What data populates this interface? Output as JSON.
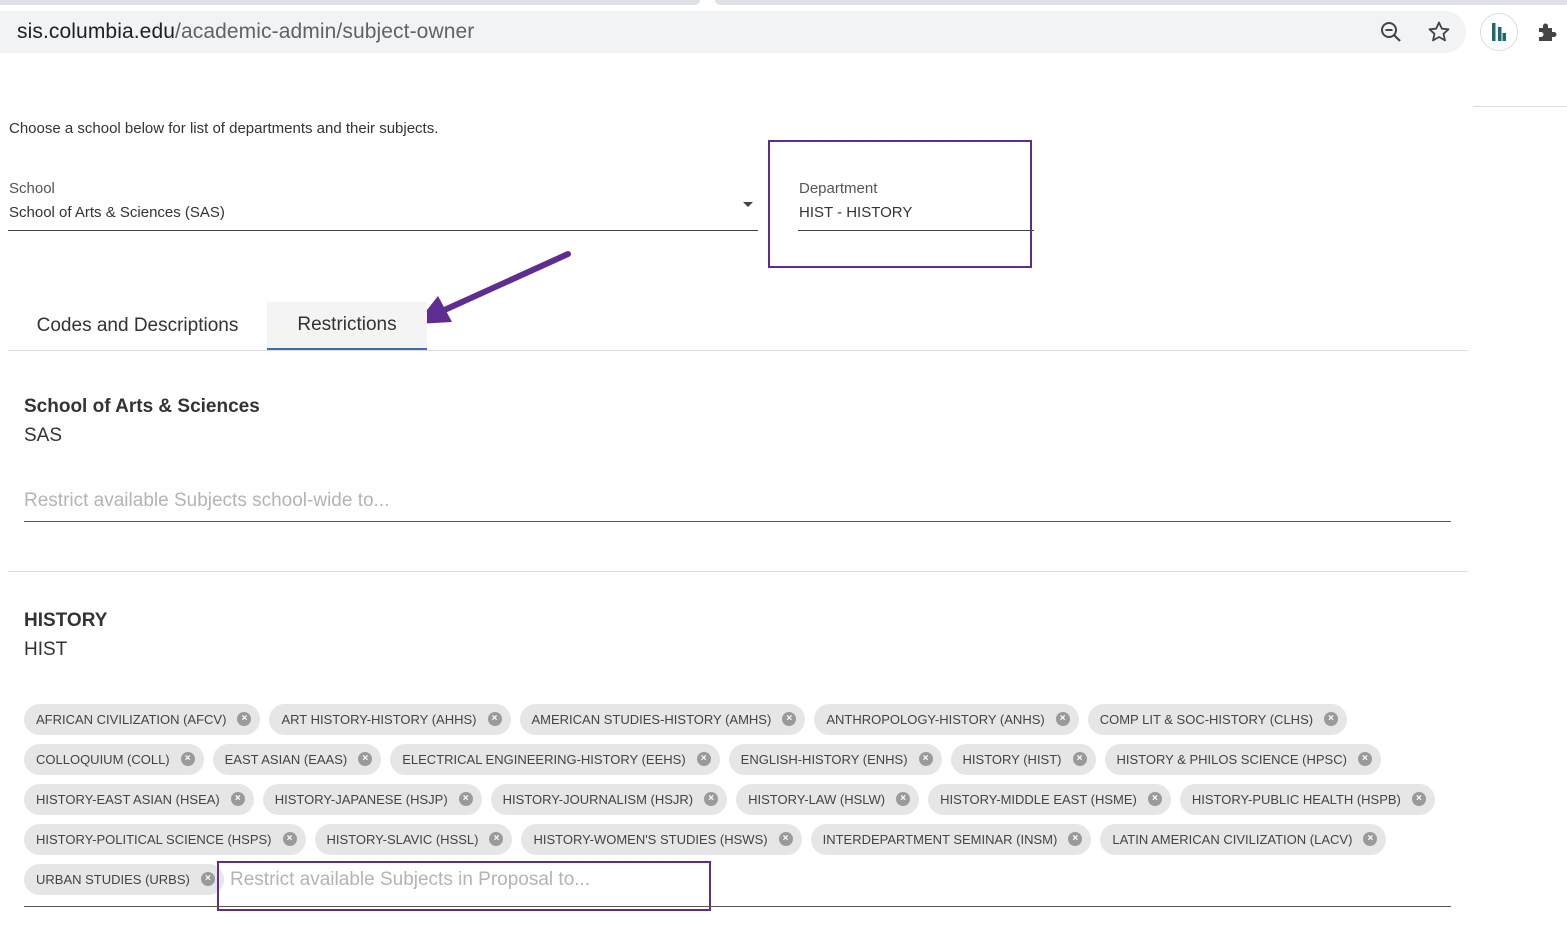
{
  "browser": {
    "url_host": "sis.columbia.edu",
    "url_path": "/academic-admin/subject-owner"
  },
  "intro": "Choose a school below for list of departments and their subjects.",
  "school_field": {
    "label": "School",
    "value": "School of Arts & Sciences (SAS)"
  },
  "department_field": {
    "label": "Department",
    "value": "HIST - HISTORY"
  },
  "tabs": [
    {
      "label": "Codes and Descriptions",
      "active": false
    },
    {
      "label": "Restrictions",
      "active": true
    }
  ],
  "school_section": {
    "title": "School of Arts & Sciences",
    "code": "SAS",
    "placeholder": "Restrict available Subjects school-wide to..."
  },
  "department_section": {
    "title": "HISTORY",
    "code": "HIST",
    "placeholder": "Restrict available Subjects in Proposal to...",
    "chip_rows": [
      [
        "AFRICAN CIVILIZATION (AFCV)",
        "ART HISTORY-HISTORY (AHHS)",
        "AMERICAN STUDIES-HISTORY (AMHS)",
        "ANTHROPOLOGY-HISTORY (ANHS)",
        "COMP LIT & SOC-HISTORY (CLHS)"
      ],
      [
        "COLLOQUIUM (COLL)",
        "EAST ASIAN (EAAS)",
        "ELECTRICAL ENGINEERING-HISTORY (EEHS)",
        "ENGLISH-HISTORY (ENHS)",
        "HISTORY (HIST)",
        "HISTORY & PHILOS SCIENCE (HPSC)"
      ],
      [
        "HISTORY-EAST ASIAN (HSEA)",
        "HISTORY-JAPANESE (HSJP)",
        "HISTORY-JOURNALISM (HSJR)",
        "HISTORY-LAW (HSLW)",
        "HISTORY-MIDDLE EAST (HSME)",
        "HISTORY-PUBLIC HEALTH (HSPB)"
      ],
      [
        "HISTORY-POLITICAL SCIENCE (HSPS)",
        "HISTORY-SLAVIC (HSSL)",
        "HISTORY-WOMEN'S STUDIES (HSWS)",
        "INTERDEPARTMENT SEMINAR (INSM)",
        "LATIN AMERICAN CIVILIZATION (LACV)"
      ],
      [
        "URBAN STUDIES (URBS)"
      ]
    ]
  },
  "colors": {
    "annotation": "#5e2d91",
    "tab_underline": "#3d6ea8"
  }
}
